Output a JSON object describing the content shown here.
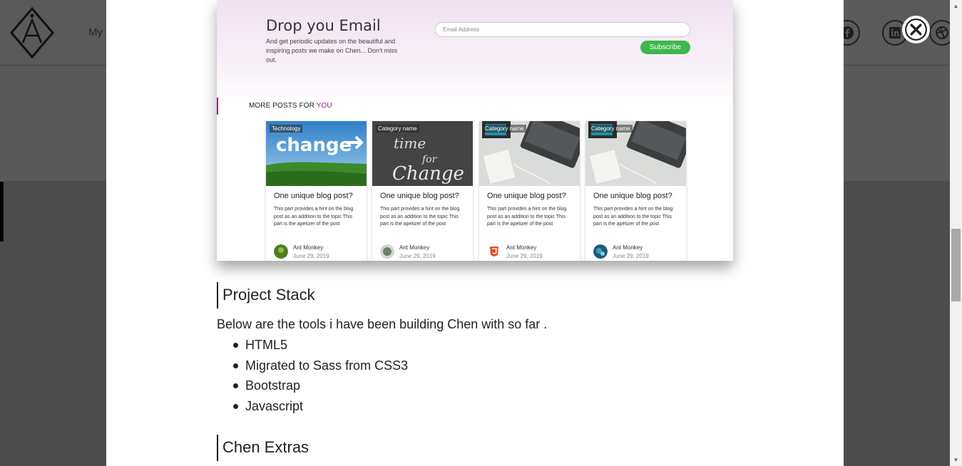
{
  "background": {
    "nav_label": "My",
    "social_icons": [
      "facebook-icon",
      "linkedin-icon",
      "dribbble-icon"
    ]
  },
  "modal": {
    "newsletter": {
      "title": "Drop you Email",
      "subtitle": "And get periodic updates on the beautiful and inspiring posts we make on Chen... Don't miss out.",
      "email_placeholder": "Email Address",
      "subscribe_label": "Subscribe"
    },
    "more_posts": {
      "prefix": "MORE POSTS FOR",
      "accent": "YOU"
    },
    "cards": [
      {
        "category": "Technology",
        "title": "One unique blog post?",
        "text": "This part provides a hint on the blog post as an addition to the topic This part is the apetizer of the post",
        "author": "Ant Monkey",
        "date": "June 29, 2019"
      },
      {
        "category": "Category name",
        "title": "One unique blog post?",
        "text": "This part provides a hint on the blog post as an addition to the topic This part is the apetizer of the post",
        "author": "Ant Monkey",
        "date": "June 29, 2019"
      },
      {
        "category": "Category name",
        "title": "One unique blog post?",
        "text": "This part provides a hint on the blog post as an addition to the topic This part is the apetizer of the post",
        "author": "Ant Monkey",
        "date": "June 29, 2019"
      },
      {
        "category": "Category name",
        "title": "One unique blog post?",
        "text": "This part provides a hint on the blog post as an addition to the topic This part is the apetizer of the post",
        "author": "Ant Monkey",
        "date": "June 29, 2019"
      }
    ],
    "project_stack": {
      "heading": "Project Stack",
      "intro": "Below are the tools i have been building Chen with so far .",
      "items": [
        "HTML5",
        "Migrated to Sass from CSS3",
        "Bootstrap",
        "Javascript"
      ]
    },
    "chen_extras": {
      "heading": "Chen Extras"
    }
  },
  "colors": {
    "accent_purple": "#8a1a8a",
    "subscribe_green": "#3cb84a",
    "overlay": "#4d4d4d"
  }
}
